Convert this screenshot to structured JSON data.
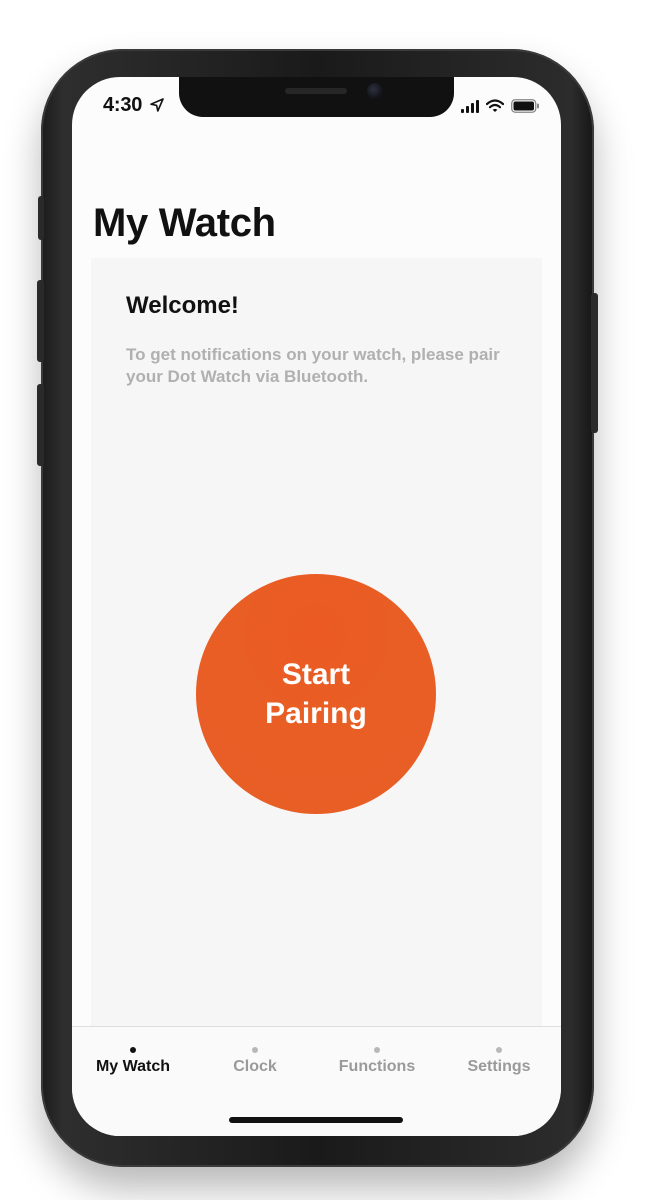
{
  "status_bar": {
    "time": "4:30",
    "icons": [
      "location-arrow-icon",
      "cellular-signal-icon",
      "wifi-icon",
      "battery-icon"
    ]
  },
  "page": {
    "title": "My Watch"
  },
  "welcome": {
    "title": "Welcome!",
    "text": "To get notifications on your watch, please pair your Dot Watch via Bluetooth."
  },
  "pair_button": {
    "label_line1": "Start",
    "label_line2": "Pairing",
    "color": "#e95e25"
  },
  "tabs": [
    {
      "label": "My Watch",
      "active": true
    },
    {
      "label": "Clock",
      "active": false
    },
    {
      "label": "Functions",
      "active": false
    },
    {
      "label": "Settings",
      "active": false
    }
  ],
  "colors": {
    "accent": "#e95e25",
    "text_primary": "#111111",
    "text_secondary": "#b0b0b0",
    "tab_inactive": "#9a9a9a"
  }
}
